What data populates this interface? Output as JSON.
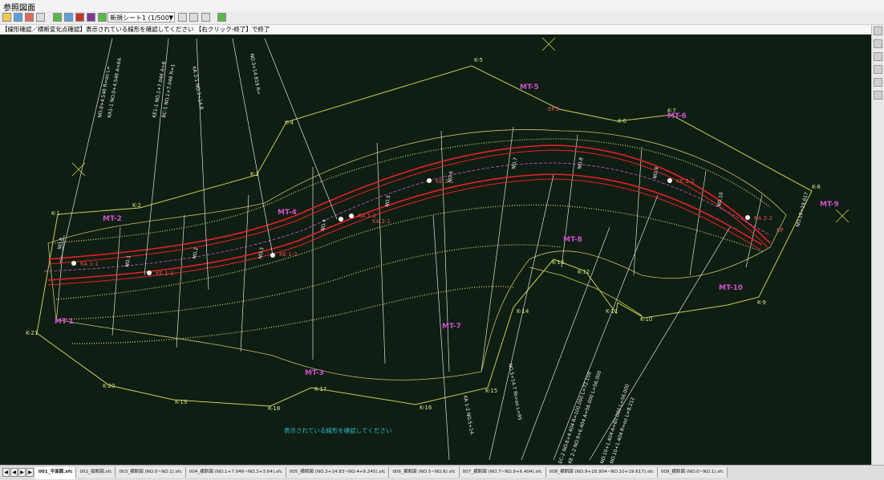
{
  "window": {
    "title": "参照図面"
  },
  "toolbar": {
    "sheet_select": "新規シート1 (1/500)"
  },
  "prompt": "【線形確認／横断変化点確認】表示されている線形を確認してください 【右クリック-終了】で終了",
  "canvas": {
    "message": "表示されている線形を確認してください",
    "boundary_points": [
      "K-1",
      "K-2",
      "K-3",
      "K-4",
      "K-5",
      "K-6",
      "K-7",
      "K-8",
      "K-9",
      "K-10",
      "K-11",
      "K-12",
      "K-13",
      "K-14",
      "K-15",
      "K-16",
      "K-17",
      "K-18",
      "K-19",
      "K-20",
      "K-21"
    ],
    "mt_labels": [
      "MT-1",
      "MT-2",
      "MT-3",
      "MT-4",
      "MT-5",
      "MT-6",
      "MT-7",
      "MT-8",
      "MT-9",
      "MT-10"
    ],
    "curve_labels": [
      "KA 1-1",
      "KE 1-1",
      "KA 1-2",
      "KE 1-2",
      "KA 2-1",
      "KE 2-1",
      "KE 2-2",
      "KA 2-2",
      "EP",
      "EP.2"
    ],
    "station_labels": [
      "NO.0",
      "NO.1",
      "NO.2",
      "NO.3",
      "NO.4",
      "NO.5",
      "NO.6",
      "NO.7",
      "NO.8",
      "NO.9",
      "NO.10"
    ],
    "annotations": [
      "NO.0+4.546 R=oo L=",
      "KA1-1 NO.0+4.546 A=64.",
      "KE1-1 NO.1+7.046 A=6",
      "BC-1 NO.1+7.046 R=1",
      "KA 2-1 NO.3+14.8",
      "NO.3+14.819 R=",
      "NO.10+19.617",
      "KA 1-2 NO.5+14.",
      "NO.5+14.7 Rt=oo L=95",
      "EC-2 NO.6+4.404 R=100.000 L=72.159",
      "KE 2-2 NO.9+6.404 A=56.000 L=56.000",
      "NO.10+1.404 A=60.000 L=56.000",
      "NO.10+1.404 R=oo L=8.212"
    ],
    "colors": {
      "background": "#0f1e12",
      "boundary": "#c8cf58",
      "alignment": "#e8202a",
      "section": "#e0e0c8",
      "hatch": "#c8c070",
      "mt": "#d050d0",
      "message": "#2fb7c8"
    }
  },
  "tabs": [
    {
      "label": "001_平面図.sfc",
      "active": true
    },
    {
      "label": "002_縦断図.sfc",
      "active": false
    },
    {
      "label": "003_横断図 (NO.0~NO.1).sfc",
      "active": false
    },
    {
      "label": "004_横断図 (NO.1+7.046~NO.3+3.64).sfc",
      "active": false
    },
    {
      "label": "005_横断図 (NO.3+14.83~NO.4+9.245).sfc",
      "active": false
    },
    {
      "label": "006_横断図 (NO.5~NO.6).sfc",
      "active": false
    },
    {
      "label": "007_横断図 (NO.7~NO.9+6.404).sfc",
      "active": false
    },
    {
      "label": "008_横断図 (NO.9+18.904~NO.10+19.617).sfc",
      "active": false
    },
    {
      "label": "009_横断図 (NO.0~NO.1).sfc",
      "active": false
    }
  ]
}
